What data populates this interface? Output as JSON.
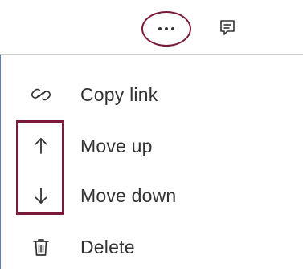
{
  "toolbar": {
    "more_icon": "more-horizontal-icon",
    "comment_icon": "comment-icon",
    "highlight_color": "#7a1b3b"
  },
  "menu": {
    "items": [
      {
        "label": "Copy link",
        "icon": "link-icon"
      },
      {
        "label": "Move up",
        "icon": "arrow-up-icon"
      },
      {
        "label": "Move down",
        "icon": "arrow-down-icon"
      },
      {
        "label": "Delete",
        "icon": "trash-icon"
      }
    ]
  }
}
